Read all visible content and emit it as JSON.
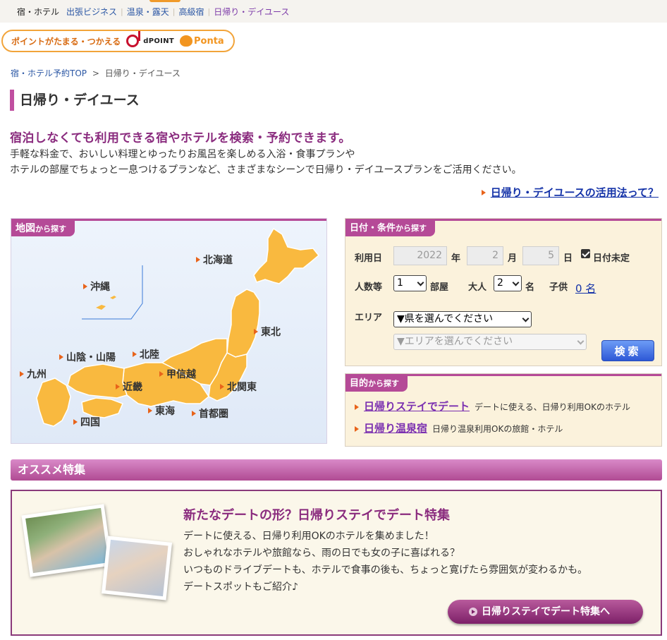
{
  "nav": {
    "items": [
      {
        "label": "宿・ホテル"
      },
      {
        "label": "出張ビジネス"
      },
      {
        "label": "温泉・露天"
      },
      {
        "label": "高級宿"
      },
      {
        "label": "日帰り・デイユース"
      }
    ]
  },
  "points": {
    "text": "ポイントがたまる・つかえる",
    "dpoint": "dPOINT",
    "ponta": "Ponta"
  },
  "breadcrumb": {
    "home": "宿・ホテル予約TOP",
    "sep": ">",
    "current": "日帰り・デイユース"
  },
  "page": {
    "title": "日帰り・デイユース",
    "lead": "宿泊しなくても利用できる宿やホテルを検索・予約できます。",
    "desc_line1": "手軽な料金で、おいしい料理とゆったりお風呂を楽しめる入浴・食事プランや",
    "desc_line2": "ホテルの部屋でちょっと一息つけるプランなど、さまざまなシーンで日帰り・デイユースプランをご活用ください。",
    "howto_link": "日帰り・デイユースの活用法って？"
  },
  "map": {
    "tab_main": "地図",
    "tab_sub": "から探す",
    "regions": {
      "hokkaido": "北海道",
      "tohoku": "東北",
      "kitakanto": "北関東",
      "shutoken": "首都圏",
      "koshinetsu": "甲信越",
      "hokuriku": "北陸",
      "tokai": "東海",
      "kinki": "近畿",
      "sanin": "山陰・山陽",
      "shikoku": "四国",
      "kyushu": "九州",
      "okinawa": "沖縄"
    }
  },
  "search": {
    "tab_main": "日付・条件",
    "tab_sub": "から探す",
    "date_label": "利用日",
    "year": "2022",
    "year_unit": "年",
    "month": "2",
    "month_unit": "月",
    "day": "5",
    "day_unit": "日",
    "undecided_label": "日付未定",
    "people_label": "人数等",
    "rooms": "1",
    "rooms_unit": "部屋",
    "adults_label": "大人",
    "adults": "2",
    "adults_unit": "名",
    "children_label": "子供",
    "children_link": "0 名",
    "area_label": "エリア",
    "pref_select": "▼県を選んでください",
    "area_select": "▼エリアを選んでください",
    "submit": "検索"
  },
  "purpose": {
    "tab_main": "目的",
    "tab_sub": "から探す",
    "items": [
      {
        "link": "日帰りステイでデート",
        "desc": "デートに使える、日帰り利用OKのホテル"
      },
      {
        "link": "日帰り温泉宿",
        "desc": "日帰り温泉利用OKの旅館・ホテル"
      }
    ]
  },
  "featured": {
    "header": "オススメ特集",
    "title": "新たなデートの形？日帰りステイでデート特集",
    "line1": "デートに使える、日帰り利用OKのホテルを集めました！",
    "line2": "おしゃれなホテルや旅館なら、雨の日でも女の子に喜ばれる？",
    "line3": "いつものドライブデートも、ホテルで食事の後も、ちょっと寛げたら雰囲気が変わるかも。",
    "line4": "デートスポットもご紹介♪",
    "button": "日帰りステイでデート特集へ"
  }
}
